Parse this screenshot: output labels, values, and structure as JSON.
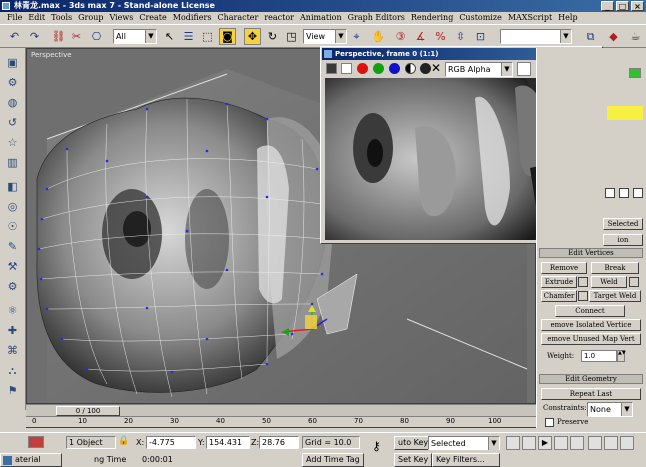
{
  "window": {
    "title": "林青龙.max - 3ds max 7 - Stand-alone License",
    "controls": [
      "_",
      "□",
      "×"
    ]
  },
  "menu": [
    "File",
    "Edit",
    "Tools",
    "Group",
    "Views",
    "Create",
    "Modifiers",
    "Character",
    "reactor",
    "Animation",
    "Graph Editors",
    "Rendering",
    "Customize",
    "MAXScript",
    "Help"
  ],
  "toolbar": {
    "selection_filter": "All",
    "ref_coord": "View",
    "named_selection": ""
  },
  "viewport": {
    "label": "Perspective"
  },
  "render_window": {
    "title": "Perspective, frame 0 (1:1)",
    "channel": "RGB Alpha",
    "close": "×"
  },
  "command_panel": {
    "selected_label": "Selected",
    "selection_rollout_tail": "ion",
    "edit_vertices": {
      "title": "Edit Vertices",
      "remove": "Remove",
      "break": "Break",
      "extrude": "Extrude",
      "weld": "Weld",
      "chamfer": "Chamfer",
      "target_weld": "Target Weld",
      "connect": "Connect",
      "remove_isolated": "emove Isolated Vertice",
      "remove_unused": "emove Unused Map Vert",
      "weight_label": "Weight:",
      "weight_value": "1.0"
    },
    "edit_geometry": {
      "title": "Edit Geometry",
      "repeat_last": "Repeat Last",
      "constraints_label": "Constraints:",
      "constraints_value": "None",
      "preserve": "Preserve"
    }
  },
  "timeline": {
    "slider_label": "0 / 100",
    "ticks": [
      "0",
      "10",
      "20",
      "30",
      "40",
      "50",
      "60",
      "70",
      "80",
      "90",
      "100"
    ]
  },
  "status": {
    "objects": "1 Object",
    "x_label": "X:",
    "x_value": "-4.775",
    "y_label": "Y:",
    "y_value": "154.431",
    "z_label": "Z:",
    "z_value": "28.76",
    "grid": "Grid = 10.0",
    "auto_key": "uto Key",
    "selected": "Selected",
    "set_key": "Set Key",
    "key_filters": "Key Filters...",
    "time_label": "ng Time",
    "time_value": "0:00:01",
    "add_time_tag": "Add Time Tag",
    "taskbar_item": "aterial"
  },
  "colors": {
    "titlebar_start": "#0a246a",
    "titlebar_end": "#3a6ea5",
    "active_tool": "#f7d33a",
    "ui_gray": "#d4d0c8",
    "viewport_bg": "#6f6f6f"
  },
  "icons": {
    "toolbar": [
      "undo-icon",
      "redo-icon",
      "link-icon",
      "unlink-icon",
      "bind-icon",
      "select-icon",
      "select-by-name-icon",
      "rect-region-icon",
      "window-crossing-icon",
      "move-icon",
      "rotate-icon",
      "scale-icon",
      "pivot-icon",
      "mirror-icon",
      "align-icon",
      "layer-icon",
      "curve-icon",
      "schematic-icon",
      "material-icon",
      "render-scene-icon",
      "quick-render-icon",
      "teapot-icon"
    ]
  }
}
